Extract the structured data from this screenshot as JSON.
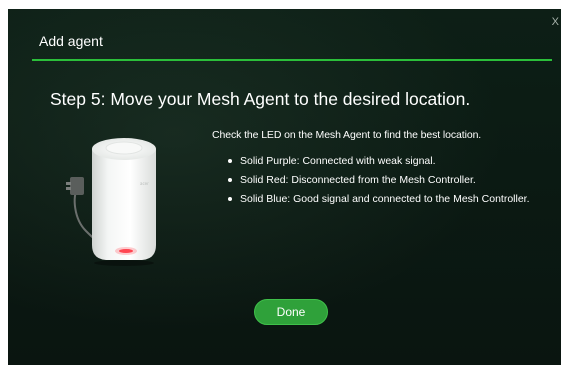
{
  "dialog": {
    "title": "Add agent",
    "close_label": "X",
    "accent_color": "#2bbf3a"
  },
  "step": {
    "heading": "Step 5: Move your Mesh Agent to the desired location."
  },
  "device": {
    "icon": "mesh-agent-device",
    "brand_mark": "acer",
    "led_color": "#e0303a"
  },
  "instructions": {
    "intro": "Check the LED on the Mesh Agent to find the best location.",
    "items": [
      {
        "label": "Solid Purple: Connected with weak signal."
      },
      {
        "label": "Solid Red: Disconnected from the Mesh Controller."
      },
      {
        "label": "Solid Blue: Good signal and connected to the Mesh Controller."
      }
    ]
  },
  "actions": {
    "done_label": "Done",
    "done_color": "#2fa13a"
  }
}
